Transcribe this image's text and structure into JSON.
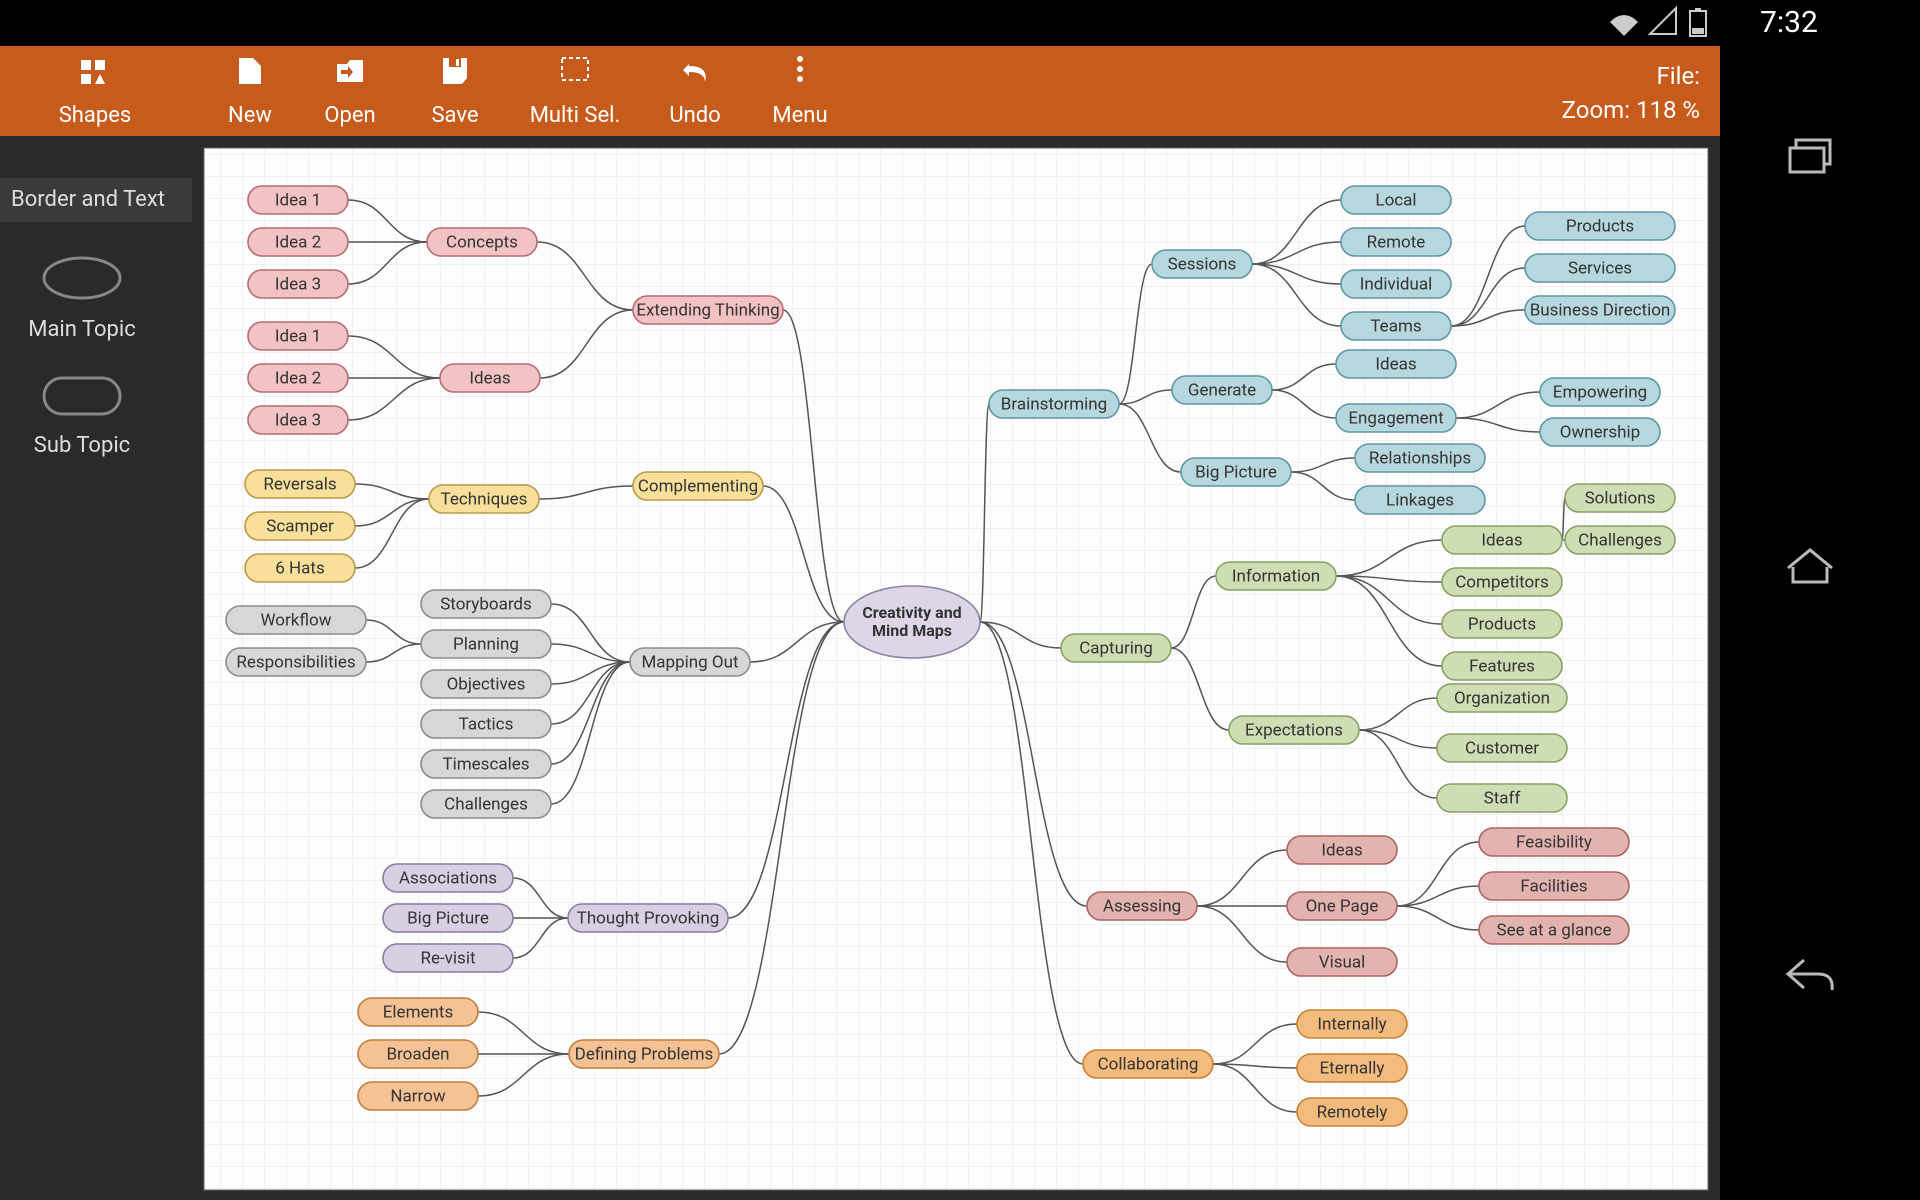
{
  "statusbar": {
    "time": "7:32"
  },
  "toolbar": {
    "shapes": "Shapes",
    "new": "New",
    "open": "Open",
    "save": "Save",
    "multisel": "Multi Sel.",
    "undo": "Undo",
    "menu": "Menu",
    "file_label": "File:",
    "zoom_label": "Zoom:  118 %"
  },
  "sidebar": {
    "header": "Border and Text",
    "main_topic": "Main Topic",
    "sub_topic": "Sub Topic"
  },
  "mindmap": {
    "root": "Creativity and Mind Maps",
    "left": {
      "extending_thinking": {
        "label": "Extending Thinking",
        "concepts": {
          "label": "Concepts",
          "children": [
            "Idea 1",
            "Idea 2",
            "Idea 3"
          ]
        },
        "ideas": {
          "label": "Ideas",
          "children": [
            "Idea 1",
            "Idea 2",
            "Idea 3"
          ]
        }
      },
      "complementing": {
        "label": "Complementing",
        "techniques": {
          "label": "Techniques",
          "children": [
            "Reversals",
            "Scamper",
            "6 Hats"
          ]
        }
      },
      "mapping_out": {
        "label": "Mapping Out",
        "children": [
          "Storyboards",
          "Planning",
          "Objectives",
          "Tactics",
          "Timescales",
          "Challenges"
        ],
        "planning_children": [
          "Workflow",
          "Responsibilities"
        ]
      },
      "thought_provoking": {
        "label": "Thought Provoking",
        "children": [
          "Associations",
          "Big Picture",
          "Re-visit"
        ]
      },
      "defining_problems": {
        "label": "Defining Problems",
        "children": [
          "Elements",
          "Broaden",
          "Narrow"
        ]
      }
    },
    "right": {
      "brainstorming": {
        "label": "Brainstorming",
        "sessions": {
          "label": "Sessions",
          "children": [
            "Local",
            "Remote",
            "Individual",
            "Teams"
          ],
          "teams_children": [
            "Products",
            "Services",
            "Business Direction"
          ]
        },
        "generate": {
          "label": "Generate",
          "children": [
            "Ideas",
            "Engagement"
          ],
          "engagement_children": [
            "Empowering",
            "Ownership"
          ]
        },
        "big_picture": {
          "label": "Big Picture",
          "children": [
            "Relationships",
            "Linkages"
          ]
        }
      },
      "capturing": {
        "label": "Capturing",
        "information": {
          "label": "Information",
          "children": [
            "Ideas",
            "Competitors",
            "Products",
            "Features"
          ],
          "ideas_children": [
            "Solutions",
            "Challenges"
          ]
        },
        "expectations": {
          "label": "Expectations",
          "children": [
            "Organization",
            "Customer",
            "Staff"
          ]
        }
      },
      "assessing": {
        "label": "Assessing",
        "children": [
          "Ideas",
          "One Page",
          "Visual"
        ],
        "onepage_children": [
          "Feasibility",
          "Facilities",
          "See at a glance"
        ]
      },
      "collaborating": {
        "label": "Collaborating",
        "children": [
          "Internally",
          "Eternally",
          "Remotely"
        ]
      }
    }
  }
}
